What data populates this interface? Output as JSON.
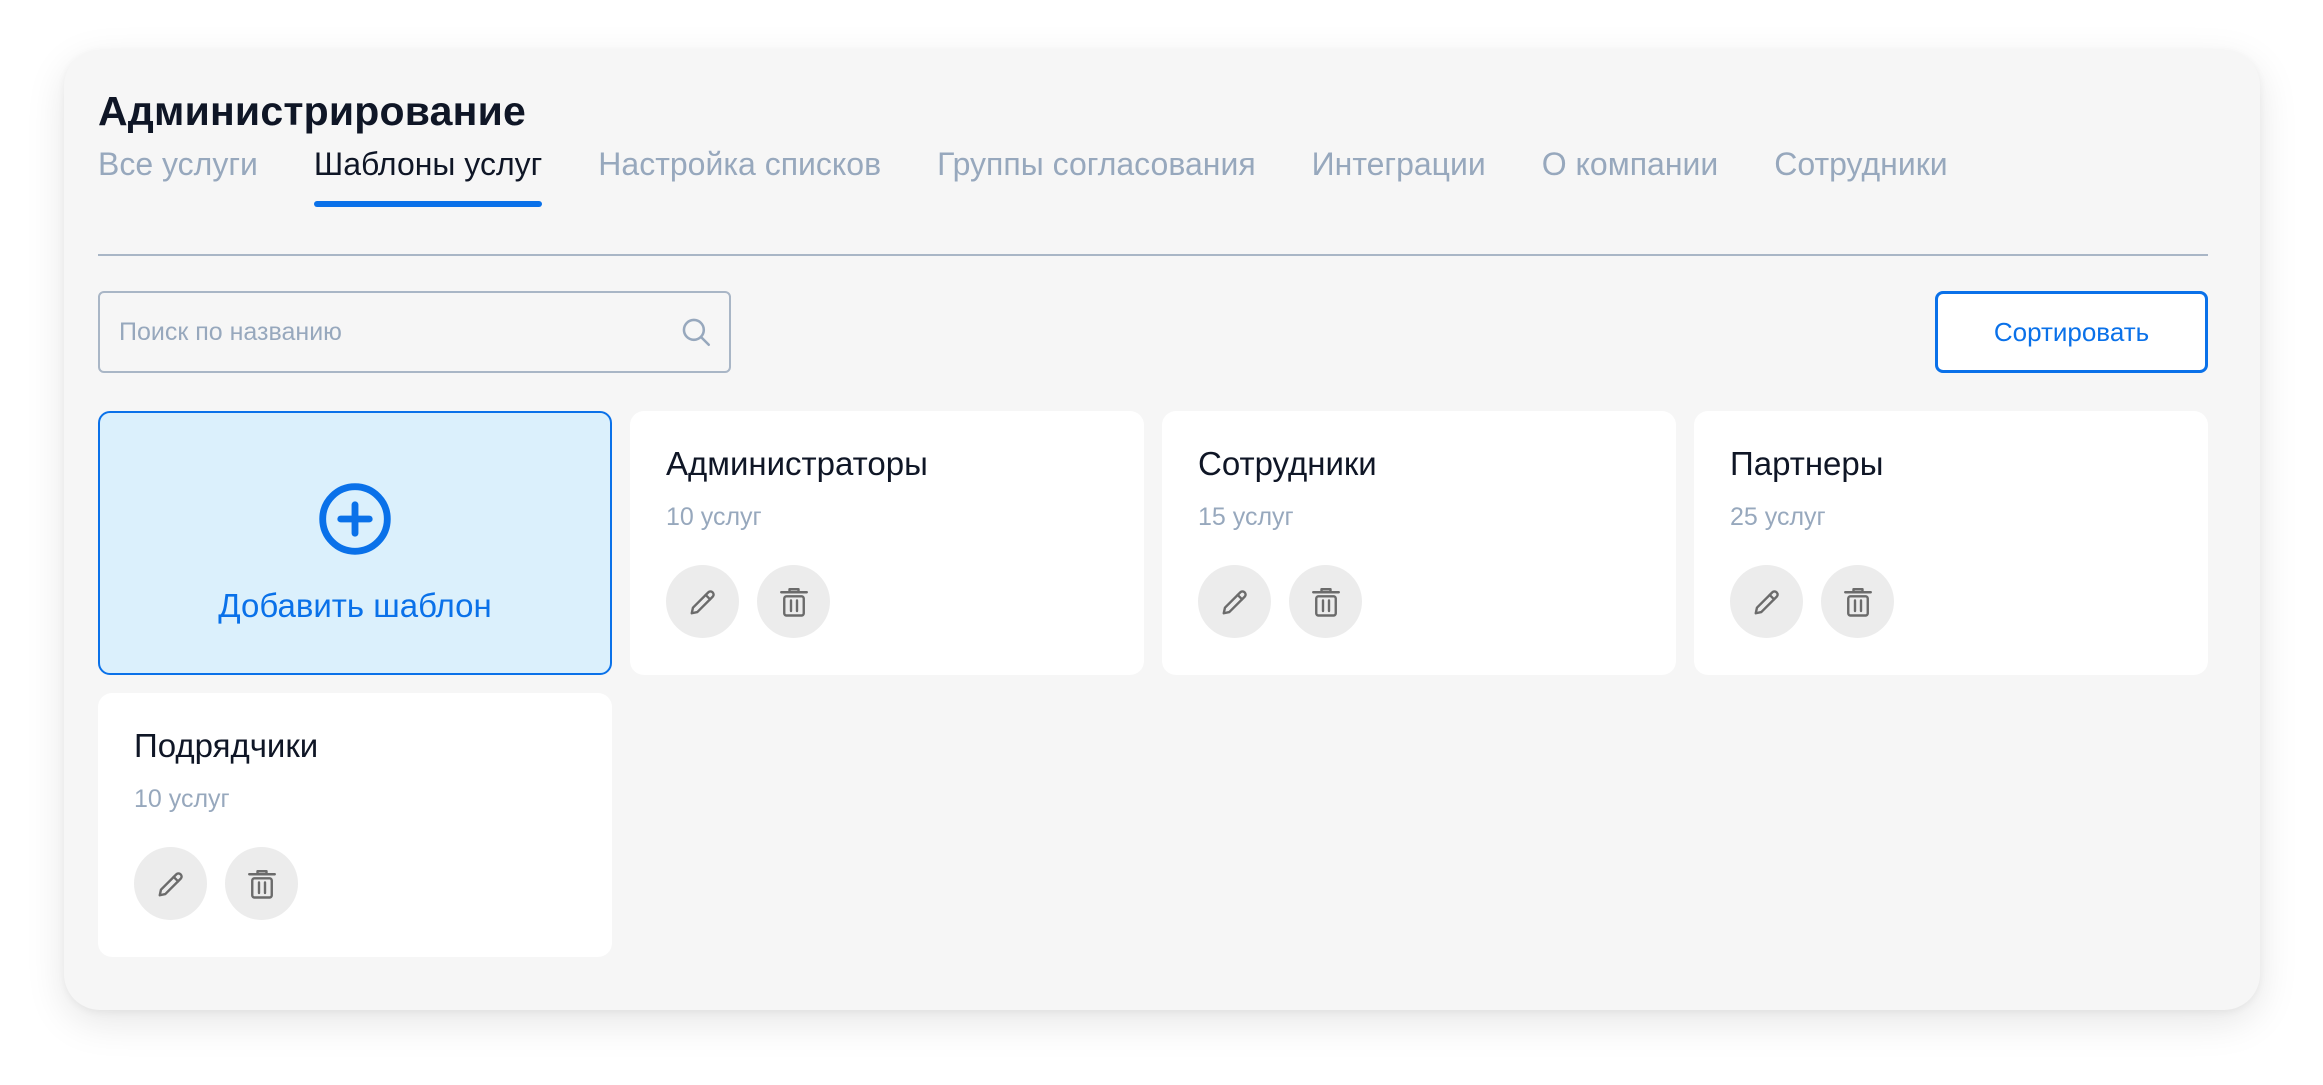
{
  "page": {
    "title": "Администрирование"
  },
  "tabs": [
    {
      "label": "Все услуги",
      "active": false
    },
    {
      "label": "Шаблоны услуг",
      "active": true
    },
    {
      "label": "Настройка списков",
      "active": false
    },
    {
      "label": "Группы согласования",
      "active": false
    },
    {
      "label": "Интеграции",
      "active": false
    },
    {
      "label": "О компании",
      "active": false
    },
    {
      "label": "Сотрудники",
      "active": false
    }
  ],
  "search": {
    "placeholder": "Поиск по названию",
    "value": "",
    "icon": "search-icon"
  },
  "toolbar": {
    "sort_label": "Сортировать"
  },
  "add_card": {
    "label": "Добавить шаблон",
    "icon": "plus-circle-icon"
  },
  "templates": [
    {
      "title": "Администраторы",
      "count": "10 услуг"
    },
    {
      "title": "Сотрудники",
      "count": "15 услуг"
    },
    {
      "title": "Партнеры",
      "count": "25 услуг"
    },
    {
      "title": "Подрядчики",
      "count": "10 услуг"
    }
  ],
  "colors": {
    "accent": "#0a71e9",
    "muted_text": "#97a8bd",
    "primary_text": "#0f1626",
    "panel_bg": "#f6f6f6",
    "add_card_bg": "#dbf0fc",
    "icon_button_bg": "#ececec"
  }
}
